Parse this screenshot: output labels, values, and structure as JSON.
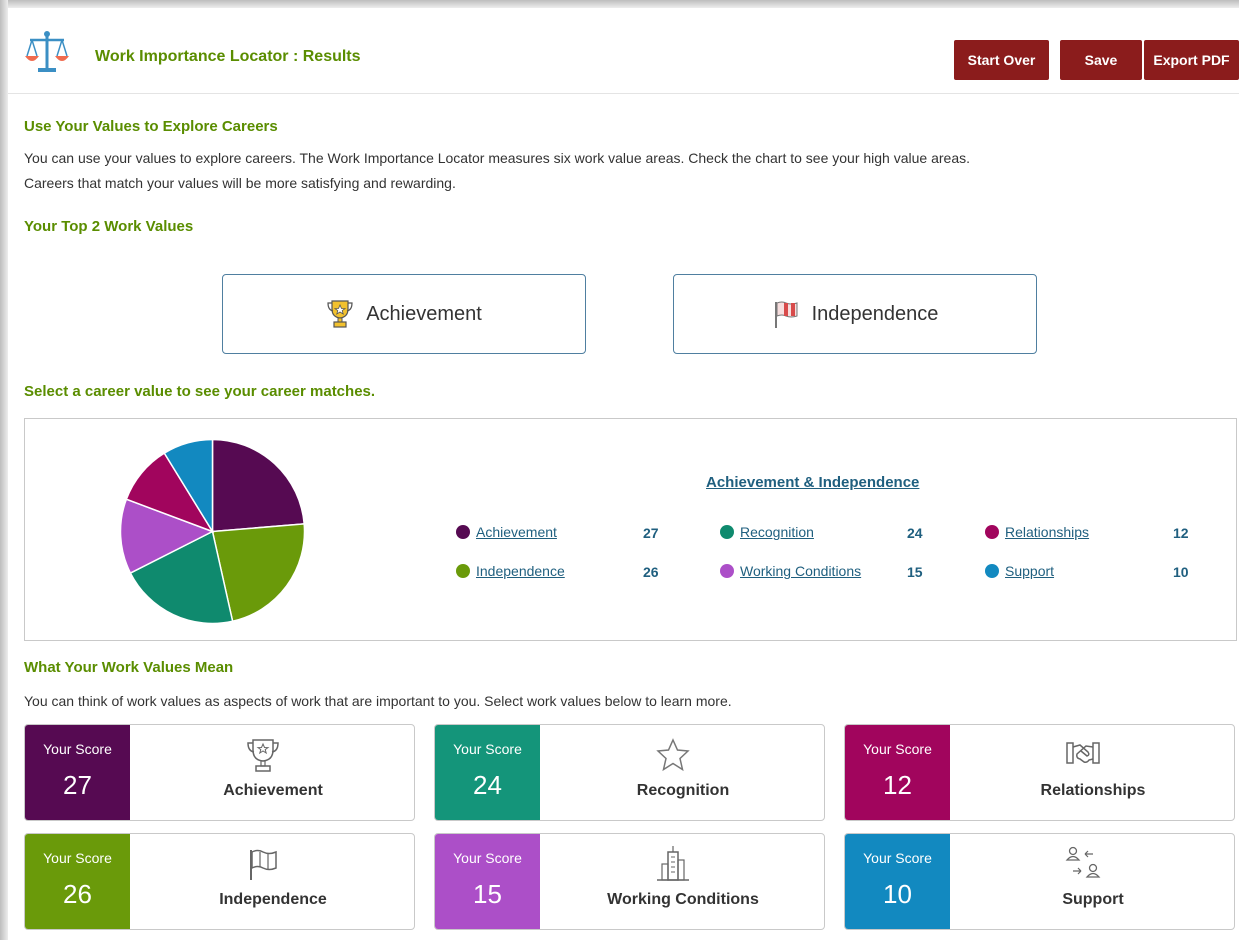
{
  "app": {
    "title": "Work Importance Locator : Results",
    "buttons": {
      "start_over": "Start Over",
      "save": "Save",
      "export_pdf": "Export PDF"
    }
  },
  "explore": {
    "heading": "Use Your Values to Explore Careers",
    "text_line1": "You can use your values to explore careers. The Work Importance Locator measures six work value areas. Check the chart to see your high value areas.",
    "text_line2": "Careers that match your values will be more satisfying and rewarding."
  },
  "top_values": {
    "heading": "Your Top 2 Work Values",
    "items": [
      {
        "label": "Achievement",
        "icon": "trophy-icon"
      },
      {
        "label": "Independence",
        "icon": "flag-icon"
      }
    ]
  },
  "select_prompt": "Select a career value to see your career matches.",
  "combo_link": "Achievement & Independence",
  "chart_data": {
    "type": "pie",
    "slices": [
      {
        "label": "Achievement",
        "value": 27,
        "color": "#560a52"
      },
      {
        "label": "Independence",
        "value": 26,
        "color": "#6a9a0a"
      },
      {
        "label": "Recognition",
        "value": 24,
        "color": "#0f8a6e"
      },
      {
        "label": "Working Conditions",
        "value": 15,
        "color": "#ac4fc8"
      },
      {
        "label": "Relationships",
        "value": 12,
        "color": "#a1055d"
      },
      {
        "label": "Support",
        "value": 10,
        "color": "#1289c0"
      }
    ],
    "legend_placement": "right"
  },
  "meaning": {
    "heading": "What Your Work Values Mean",
    "text": "You can think of work values as aspects of work that are important to you. Select work values below to learn more.",
    "score_label": "Your Score",
    "cards": [
      {
        "name": "Achievement",
        "score": "27",
        "color": "#560a52",
        "icon": "trophy-icon"
      },
      {
        "name": "Recognition",
        "score": "24",
        "color": "#14957a",
        "icon": "star-icon"
      },
      {
        "name": "Relationships",
        "score": "12",
        "color": "#a1055d",
        "icon": "handshake-icon"
      },
      {
        "name": "Independence",
        "score": "26",
        "color": "#6a9a0a",
        "icon": "flag-icon"
      },
      {
        "name": "Working Conditions",
        "score": "15",
        "color": "#ac4fc8",
        "icon": "building-icon"
      },
      {
        "name": "Support",
        "score": "10",
        "color": "#1289c0",
        "icon": "people-exchange-icon"
      }
    ]
  }
}
